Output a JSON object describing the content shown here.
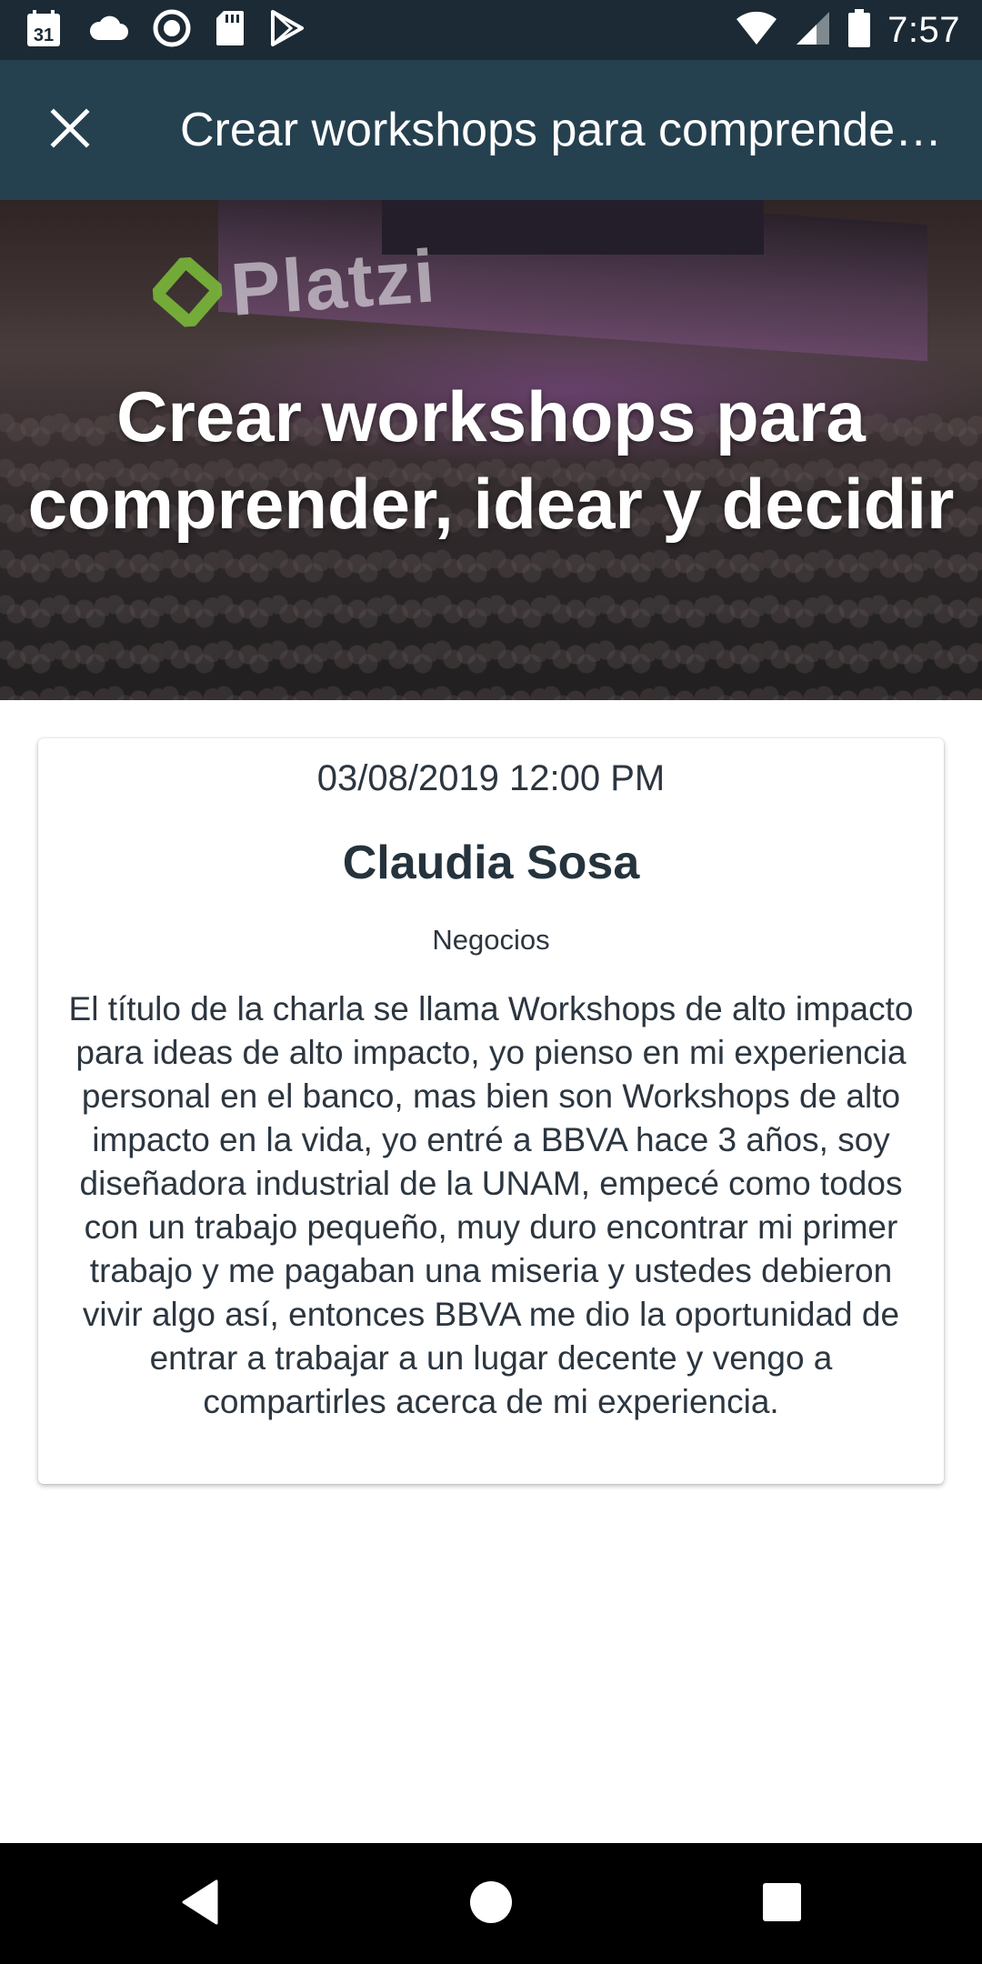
{
  "status_bar": {
    "time": "7:57",
    "calendar_day": "31",
    "icons_left": [
      "calendar-icon",
      "cloud-icon",
      "record-icon",
      "sd-card-icon",
      "play-store-icon"
    ],
    "icons_right": [
      "wifi-icon",
      "cell-signal-icon",
      "battery-icon"
    ]
  },
  "app_bar": {
    "close_icon": "close-icon",
    "title": "Crear workshops para comprender, idear y decidir"
  },
  "hero": {
    "logo_text": "Platzi",
    "title": "Crear workshops para comprender, idear y decidir"
  },
  "card": {
    "datetime": "03/08/2019 12:00 PM",
    "speaker": "Claudia Sosa",
    "category": "Negocios",
    "description": "El título de la charla se llama Workshops de alto impacto para ideas de alto impacto, yo pienso en mi experiencia personal en el banco, mas bien son Workshops de alto impacto en la vida, yo entré a BBVA hace 3 años, soy diseñadora industrial de la UNAM, empecé como todos con un trabajo pequeño, muy duro encontrar mi primer trabajo y me pagaban una miseria y ustedes debieron vivir algo así, entonces BBVA me dio la oportunidad de entrar a trabajar a un lugar decente y vengo a compartirles acerca de mi experiencia."
  },
  "nav_bar": {
    "icons": [
      "back-icon",
      "home-icon",
      "recents-icon"
    ]
  },
  "colors": {
    "status_bar": "#1b2a34",
    "app_bar": "#25404f",
    "text_dark": "#25333d",
    "nav_bar": "#000000"
  }
}
